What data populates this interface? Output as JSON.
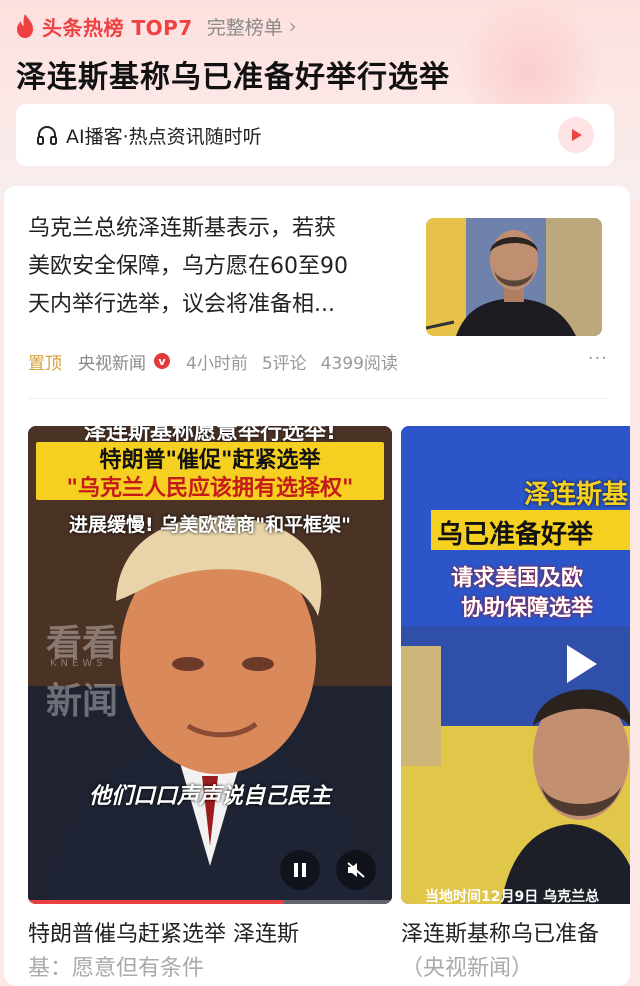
{
  "header": {
    "brand": "头条热榜 TOP7",
    "full_list": "完整榜单",
    "chevron": "›"
  },
  "headline": "泽连斯基称乌已准备好举行选举",
  "podcast": {
    "label": "AI播客·热点资讯随时听"
  },
  "article": {
    "summary_lines": [
      "乌克兰总统泽连斯基表示，若获",
      "美欧安全保障，乌方愿在60至90",
      "天内举行选举，议会将准备相..."
    ],
    "pinned": "置顶",
    "source": "央视新闻",
    "verified_badge": "v",
    "time": "4小时前",
    "comments": "5评论",
    "reads": "4399阅读",
    "more": "···"
  },
  "video1": {
    "top_cut": "泽连斯基称愿意举行选举!",
    "banner_line1": "特朗普\"催促\"赶紧选举",
    "banner_line2": "\"乌克兰人民应该拥有选择权\"",
    "sub_banner": "进展缓慢! 乌美欧磋商\"和平框架\"",
    "watermark_1": "看看",
    "watermark_2": "KNEWS",
    "watermark_3": "新闻",
    "subtitle": "他们口口声声说自己民主",
    "caption_line1": "特朗普催乌赶紧选举 泽连斯",
    "caption_line2": "基：愿意但有条件"
  },
  "video2": {
    "title_line1": "泽连斯基",
    "title_line2": "乌已准备好举",
    "request_line1": "请求美国及欧",
    "request_line2": "协助保障选举",
    "bottom_text": "当地时间12月9日  乌克兰总",
    "caption_line1": "泽连斯基称乌已准备",
    "caption_line2": "（央视新闻）"
  },
  "icons": {
    "flame": "flame-icon",
    "headphones": "headphones-icon",
    "play": "play-icon",
    "pause": "pause-icon",
    "mute": "mute-icon"
  },
  "colors": {
    "brand_red": "#f04142",
    "pinned_gold": "#d4a23a",
    "banner_yellow": "#f5d020"
  }
}
